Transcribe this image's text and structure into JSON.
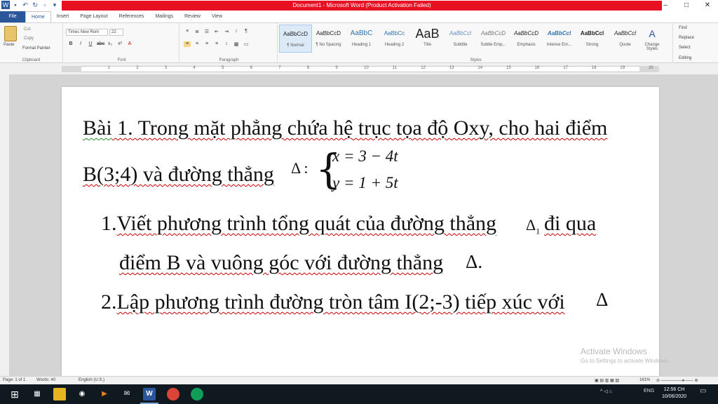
{
  "window": {
    "title": "Document1 - Microsoft Word (Product Activation Failed)",
    "minimize": "–",
    "restore": "□",
    "close": "✕"
  },
  "tabs": [
    "File",
    "Home",
    "Insert",
    "Page Layout",
    "References",
    "Mailings",
    "Review",
    "View"
  ],
  "ribbon": {
    "clipboard": {
      "paste": "Paste",
      "cut": "Cut",
      "copy": "Copy",
      "format_painter": "Format Painter",
      "label": "Clipboard"
    },
    "font": {
      "name": "Times New Rom",
      "size": "22",
      "label": "Font"
    },
    "paragraph": {
      "label": "Paragraph"
    },
    "styles": {
      "label": "Styles",
      "items": [
        {
          "preview": "AaBbCcD",
          "name": "¶ Normal"
        },
        {
          "preview": "AaBbCcD",
          "name": "¶ No Spacing"
        },
        {
          "preview": "AaBbC",
          "name": "Heading 1"
        },
        {
          "preview": "AaBbCc",
          "name": "Heading 2"
        },
        {
          "preview": "AaB",
          "name": "Title"
        },
        {
          "preview": "AaBbCcl",
          "name": "Subtitle"
        },
        {
          "preview": "AaBbCcD",
          "name": "Subtle Emp..."
        },
        {
          "preview": "AaBbCcD",
          "name": "Emphasis"
        },
        {
          "preview": "AaBbCcl",
          "name": "Intense Em..."
        },
        {
          "preview": "AaBbCcl",
          "name": "Strong"
        },
        {
          "preview": "AaBbCcl",
          "name": "Quote"
        }
      ],
      "change_styles": "Change Styles"
    },
    "editing": {
      "find": "Find",
      "replace": "Replace",
      "select": "Select",
      "label": "Editing"
    }
  },
  "ruler_numbers": [
    "1",
    "2",
    "3",
    "4",
    "5",
    "6",
    "7",
    "8",
    "9",
    "10",
    "11",
    "12",
    "13",
    "14",
    "15",
    "16",
    "17",
    "18",
    "19",
    "20"
  ],
  "document": {
    "line1_bai": "Bài",
    "line1_rest": " 1. Trong mặt phẳng chứa hệ trục tọa độ Oxy, cho hai điểm",
    "line2_point": "B(3;4) và đường thẳng",
    "line2_delta": "Δ :",
    "system_x": "x  =  3 − 4t",
    "system_y": "y  =  1 + 5t",
    "item1_num": "1.",
    "item1_text": "Viết phương trình tổng quát của đường thẳng",
    "item1_delta": "Δ",
    "item1_sub": "1",
    "item1_tail": "đi qua",
    "item1_line2": "điểm B và vuông góc với đường thẳng",
    "item1_line2_delta": "Δ.",
    "item2_num": "2.",
    "item2_text": "Lập phương trình đường tròn tâm I(2;-3) tiếp xúc với",
    "item2_delta": "Δ"
  },
  "watermark": {
    "line1": "Activate Windows",
    "line2": "Go to Settings to activate Windows."
  },
  "status": {
    "page": "Page: 1 of 1",
    "words": "Words: 40",
    "language": "English (U.S.)",
    "zoom": "161%"
  },
  "taskbar": {
    "time": "12:56 CH",
    "date": "10/06/2020",
    "lang": "ENG"
  }
}
